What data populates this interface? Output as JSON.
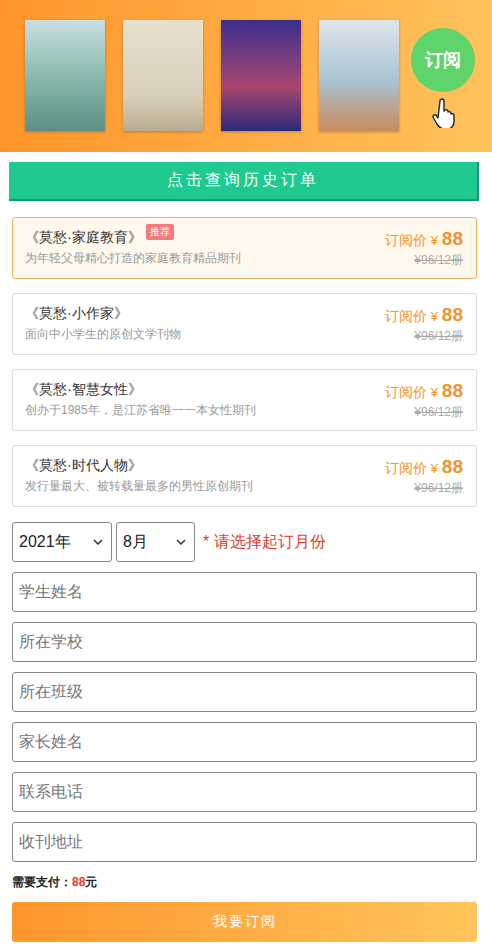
{
  "banner": {
    "subscribe_button": {
      "label": "订阅"
    }
  },
  "history_button": {
    "label": "点击查询历史订单"
  },
  "products": [
    {
      "title": "《莫愁·家庭教育》",
      "description": "为年轻父母精心打造的家庭教育精品期刊",
      "badge": "推荐",
      "price_label": "订阅价",
      "currency": "¥",
      "price": "88",
      "original_price": "¥96/12册",
      "selected": true
    },
    {
      "title": "《莫愁·小作家》",
      "description": "面向中小学生的原创文学刊物",
      "badge": null,
      "price_label": "订阅价",
      "currency": "¥",
      "price": "88",
      "original_price": "¥96/12册",
      "selected": false
    },
    {
      "title": "《莫愁·智慧女性》",
      "description": "创办于1985年，是江苏省唯一一本女性期刊",
      "badge": null,
      "price_label": "订阅价",
      "currency": "¥",
      "price": "88",
      "original_price": "¥96/12册",
      "selected": false
    },
    {
      "title": "《莫愁·时代人物》",
      "description": "发行量最大、被转载量最多的男性原创期刊",
      "badge": null,
      "price_label": "订阅价",
      "currency": "¥",
      "price": "88",
      "original_price": "¥96/12册",
      "selected": false
    }
  ],
  "start_month": {
    "year": "2021年",
    "month": "8月",
    "hint": "* 请选择起订月份"
  },
  "fields": [
    {
      "placeholder": "学生姓名"
    },
    {
      "placeholder": "所在学校"
    },
    {
      "placeholder": "所在班级"
    },
    {
      "placeholder": "家长姓名"
    },
    {
      "placeholder": "联系电话"
    },
    {
      "placeholder": "收刊地址"
    }
  ],
  "total": {
    "label": "需要支付：",
    "amount": "88",
    "unit": "元"
  },
  "submit": {
    "label": "我要订阅"
  }
}
